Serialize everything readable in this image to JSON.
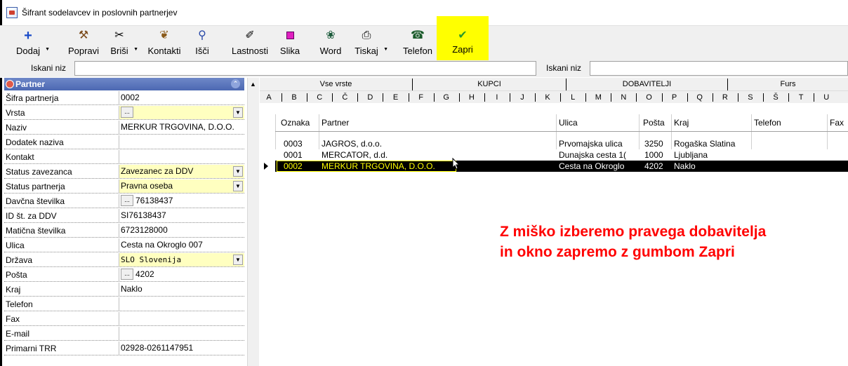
{
  "window": {
    "title": "Šifrant sodelavcev in poslovnih partnerjev"
  },
  "toolbar": {
    "buttons": [
      {
        "label": "Dodaj",
        "icon": "plus-icon"
      },
      {
        "label": "Popravi",
        "icon": "hammer-icon"
      },
      {
        "label": "Briši",
        "icon": "scissors-icon"
      },
      {
        "label": "Kontakti",
        "icon": "contacts-icon"
      },
      {
        "label": "Išči",
        "icon": "search-icon"
      },
      {
        "label": "Lastnosti",
        "icon": "properties-icon"
      },
      {
        "label": "Slika",
        "icon": "image-icon"
      },
      {
        "label": "Word",
        "icon": "word-icon"
      },
      {
        "label": "Tiskaj",
        "icon": "printer-icon"
      },
      {
        "label": "Telefon",
        "icon": "phone-icon"
      },
      {
        "label": "Zapri",
        "icon": "checkmark-icon"
      }
    ],
    "highlight_color": "#ffff00"
  },
  "search": {
    "left_label": "Iskani niz",
    "right_label": "Iskani niz",
    "left_value": "",
    "right_value": ""
  },
  "partner_panel": {
    "title": "Partner",
    "fields": [
      {
        "label": "Šifra partnerja",
        "value": "0002"
      },
      {
        "label": "Vrsta",
        "value": "...",
        "type": "dropdown-ellipsis"
      },
      {
        "label": "Naziv",
        "value": "MERKUR TRGOVINA, D.O.O."
      },
      {
        "label": "Dodatek naziva",
        "value": ""
      },
      {
        "label": "Kontakt",
        "value": ""
      },
      {
        "label": "Status zavezanca",
        "value": "Zavezanec za DDV",
        "type": "dropdown"
      },
      {
        "label": "Status partnerja",
        "value": "Pravna oseba",
        "type": "dropdown"
      },
      {
        "label": "Davčna številka",
        "value": "76138437",
        "type": "ellipsis"
      },
      {
        "label": "ID št. za DDV",
        "value": "SI76138437"
      },
      {
        "label": "Matična številka",
        "value": "6723128000"
      },
      {
        "label": "Ulica",
        "value": "Cesta na Okroglo 007"
      },
      {
        "label": "Država",
        "value": "SLO  Slovenija",
        "type": "dropdown-mono"
      },
      {
        "label": "Pošta",
        "value": "4202",
        "type": "ellipsis"
      },
      {
        "label": "Kraj",
        "value": "Naklo"
      },
      {
        "label": "Telefon",
        "value": ""
      },
      {
        "label": "Fax",
        "value": ""
      },
      {
        "label": "E-mail",
        "value": ""
      },
      {
        "label": "Primarni TRR",
        "value": "02928-0261147951"
      }
    ]
  },
  "tabs": [
    "Vse vrste",
    "KUPCI",
    "DOBAVITELJI",
    "Furs"
  ],
  "alphabet": [
    "A",
    "B",
    "C",
    "Č",
    "D",
    "E",
    "F",
    "G",
    "H",
    "I",
    "J",
    "K",
    "L",
    "M",
    "N",
    "O",
    "P",
    "Q",
    "R",
    "S",
    "Š",
    "T",
    "U"
  ],
  "grid": {
    "columns": [
      "Oznaka",
      "Partner",
      "Ulica",
      "Pošta",
      "Kraj",
      "Telefon",
      "Fax"
    ],
    "rows": [
      {
        "oznaka": "0003",
        "partner": "JAGROS, d.o.o.",
        "ulica": "Prvomajska ulica",
        "posta": "3250",
        "kraj": "Rogaška Slatina",
        "telefon": "",
        "fax": ""
      },
      {
        "oznaka": "0001",
        "partner": "MERCATOR, d.d.",
        "ulica": "Dunajska cesta 1(",
        "posta": "1000",
        "kraj": "Ljubljana",
        "telefon": "",
        "fax": ""
      },
      {
        "oznaka": "0002",
        "partner": "MERKUR TRGOVINA, D.O.O.",
        "ulica": "Cesta na Okroglo",
        "posta": "4202",
        "kraj": "Naklo",
        "telefon": "",
        "fax": ""
      }
    ]
  },
  "annotation": {
    "line1": "Z miško izberemo pravega dobavitelja",
    "line2": "in okno zapremo z gumbom Zapri",
    "color": "#ff0000"
  }
}
